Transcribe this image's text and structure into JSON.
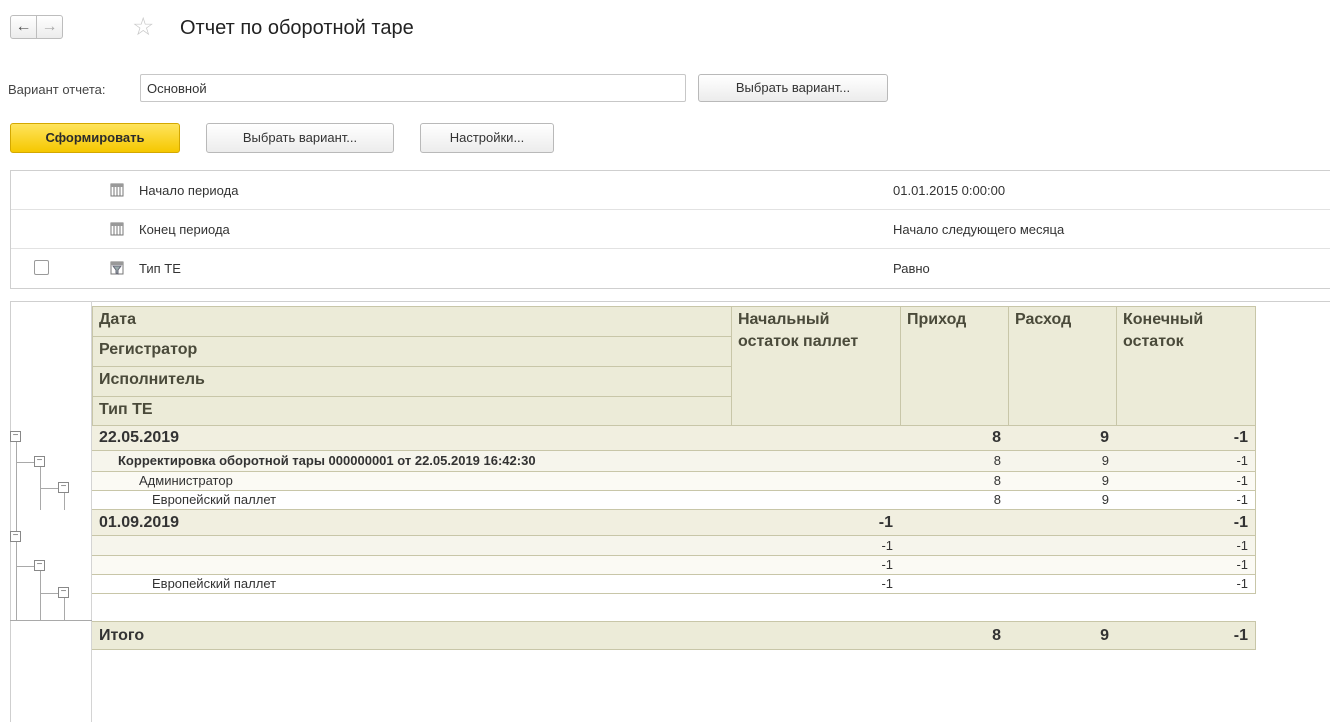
{
  "nav": {
    "back_icon": "←",
    "forward_icon": "→",
    "star_icon": "☆"
  },
  "page_title": "Отчет по оборотной таре",
  "variant": {
    "label": "Вариант отчета:",
    "value": "Основной",
    "choose_button": "Выбрать вариант..."
  },
  "toolbar": {
    "generate": "Сформировать",
    "choose_variant": "Выбрать вариант...",
    "settings": "Настройки..."
  },
  "settings": [
    {
      "label": "Начало периода",
      "value": "01.01.2015 0:00:00",
      "has_checkbox": false,
      "checked": false,
      "icon": "parameter-icon"
    },
    {
      "label": "Конец периода",
      "value": "Начало следующего месяца",
      "has_checkbox": false,
      "checked": false,
      "icon": "parameter-icon"
    },
    {
      "label": "Тип ТЕ",
      "value": "Равно",
      "has_checkbox": true,
      "checked": false,
      "icon": "filter-icon"
    }
  ],
  "report": {
    "group_headers": [
      "Дата",
      "Регистратор",
      "Исполнитель",
      "Тип ТЕ"
    ],
    "columns": [
      "Начальный остаток паллет",
      "Приход",
      "Расход",
      "Конечный остаток"
    ],
    "rows": [
      {
        "level": 0,
        "label": "22.05.2019",
        "start": "",
        "in": "8",
        "out": "9",
        "end": "-1"
      },
      {
        "level": 1,
        "label": "Корректировка оборотной тары 000000001 от 22.05.2019 16:42:30",
        "start": "",
        "in": "8",
        "out": "9",
        "end": "-1"
      },
      {
        "level": 2,
        "label": "Администратор",
        "start": "",
        "in": "8",
        "out": "9",
        "end": "-1"
      },
      {
        "level": 3,
        "label": "Европейский паллет",
        "start": "",
        "in": "8",
        "out": "9",
        "end": "-1"
      },
      {
        "level": 0,
        "label": "01.09.2019",
        "start": "-1",
        "in": "",
        "out": "",
        "end": "-1"
      },
      {
        "level": 1,
        "label": "",
        "start": "-1",
        "in": "",
        "out": "",
        "end": "-1"
      },
      {
        "level": 2,
        "label": "",
        "start": "-1",
        "in": "",
        "out": "",
        "end": "-1"
      },
      {
        "level": 3,
        "label": "Европейский паллет",
        "start": "-1",
        "in": "",
        "out": "",
        "end": "-1"
      }
    ],
    "total": {
      "label": "Итого",
      "start": "",
      "in": "8",
      "out": "9",
      "end": "-1"
    }
  }
}
